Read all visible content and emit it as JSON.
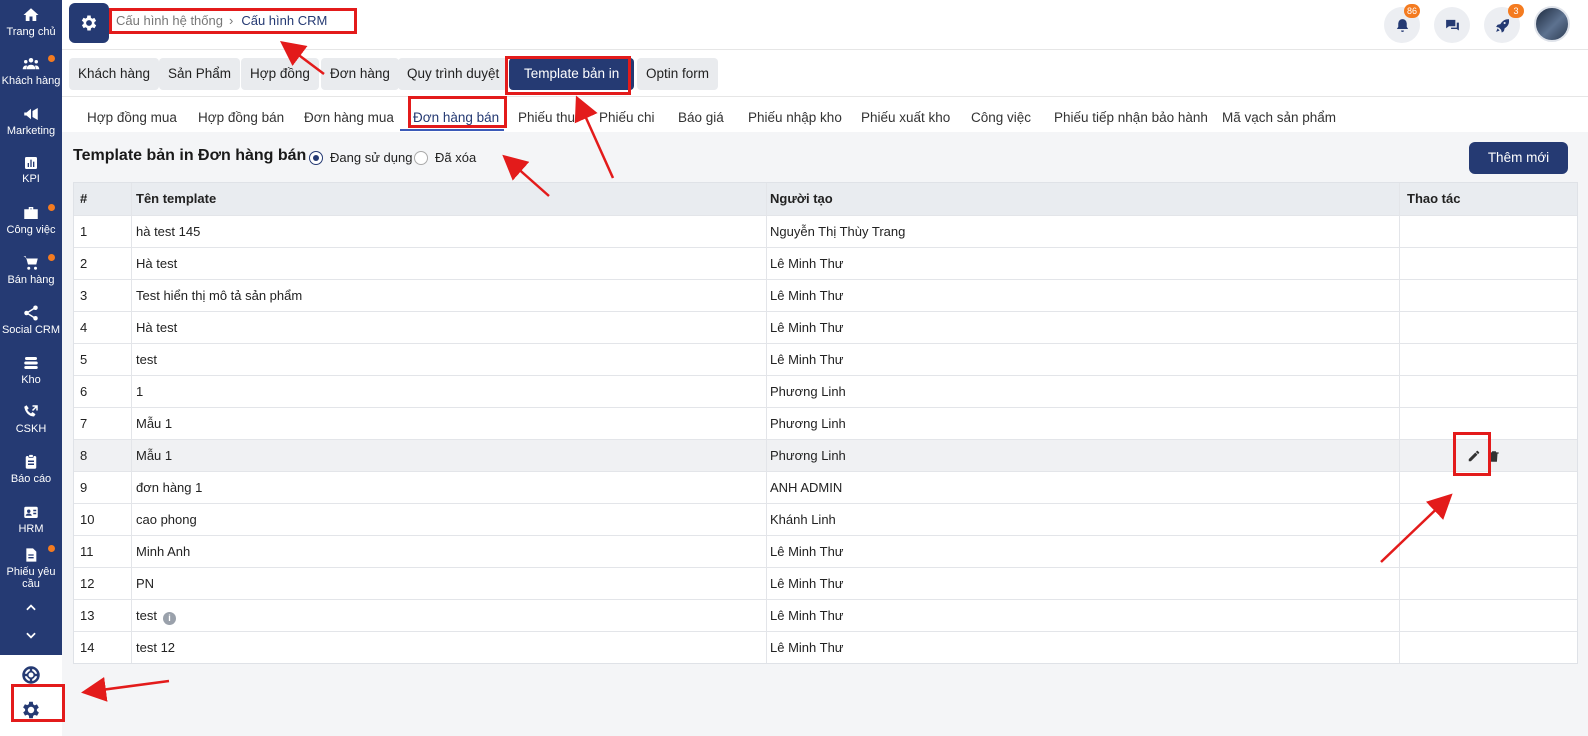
{
  "sidebar": {
    "items": [
      {
        "label": "Trang chủ",
        "icon": "home-icon"
      },
      {
        "label": "Khách hàng",
        "icon": "users-icon",
        "dot": true
      },
      {
        "label": "Marketing",
        "icon": "megaphone-icon"
      },
      {
        "label": "KPI",
        "icon": "bar-chart-icon"
      },
      {
        "label": "Công việc",
        "icon": "briefcase-icon",
        "dot": true
      },
      {
        "label": "Bán hàng",
        "icon": "cart-icon",
        "dot": true
      },
      {
        "label": "Social CRM",
        "icon": "share-icon"
      },
      {
        "label": "Kho",
        "icon": "stack-icon"
      },
      {
        "label": "CSKH",
        "icon": "phone-icon"
      },
      {
        "label": "Báo cáo",
        "icon": "clipboard-icon"
      },
      {
        "label": "HRM",
        "icon": "id-badge-icon"
      },
      {
        "label": "Phiếu yêu cầu",
        "icon": "document-icon",
        "dot": true
      }
    ]
  },
  "topbar": {
    "breadcrumb": [
      "Cấu hình hệ thống",
      "Cấu hình CRM"
    ],
    "notifications_count": "86",
    "rocket_count": "3"
  },
  "group_tabs": [
    "Khách hàng",
    "Sản Phẩm",
    "Hợp đồng",
    "Đơn hàng",
    "Quy trình duyệt",
    "Template bản in",
    "Optin form"
  ],
  "sub_tabs": [
    "Hợp đồng mua",
    "Hợp đồng bán",
    "Đơn hàng mua",
    "Đơn hàng bán",
    "Phiếu thu",
    "Phiếu chi",
    "Báo giá",
    "Phiếu nhập kho",
    "Phiếu xuất kho",
    "Công việc",
    "Phiếu tiếp nhận bảo hành",
    "Mã vạch sản phẩm"
  ],
  "page": {
    "title": "Template bản in Đơn hàng bán",
    "filter_active": "Đang sử dụng",
    "filter_deleted": "Đã xóa",
    "add_button": "Thêm mới"
  },
  "table": {
    "headers": [
      "#",
      "Tên template",
      "Người tạo",
      "Thao tác"
    ],
    "rows": [
      [
        "1",
        "hà test 145",
        "Nguyễn Thị Thùy Trang"
      ],
      [
        "2",
        "Hà test",
        "Lê Minh Thư"
      ],
      [
        "3",
        "Test hiển thị mô tả sản phẩm",
        "Lê Minh Thư"
      ],
      [
        "4",
        "Hà test",
        "Lê Minh Thư"
      ],
      [
        "5",
        "test",
        "Lê Minh Thư"
      ],
      [
        "6",
        "1",
        "Phương Linh"
      ],
      [
        "7",
        "Mẫu 1",
        "Phương Linh"
      ],
      [
        "8",
        "Mẫu 1",
        "Phương Linh"
      ],
      [
        "9",
        "đơn hàng 1",
        "ANH ADMIN"
      ],
      [
        "10",
        "cao phong",
        "Khánh Linh"
      ],
      [
        "11",
        "Minh Anh",
        "Lê Minh Thư"
      ],
      [
        "12",
        "PN",
        "Lê Minh Thư"
      ],
      [
        "13",
        "test",
        "Lê Minh Thư"
      ],
      [
        "14",
        "test 12",
        "Lê Minh Thư"
      ]
    ],
    "info_glyph": "i"
  },
  "colors": {
    "primary": "#253a73",
    "accent": "#f47b20",
    "annotation": "#e31b1b"
  }
}
